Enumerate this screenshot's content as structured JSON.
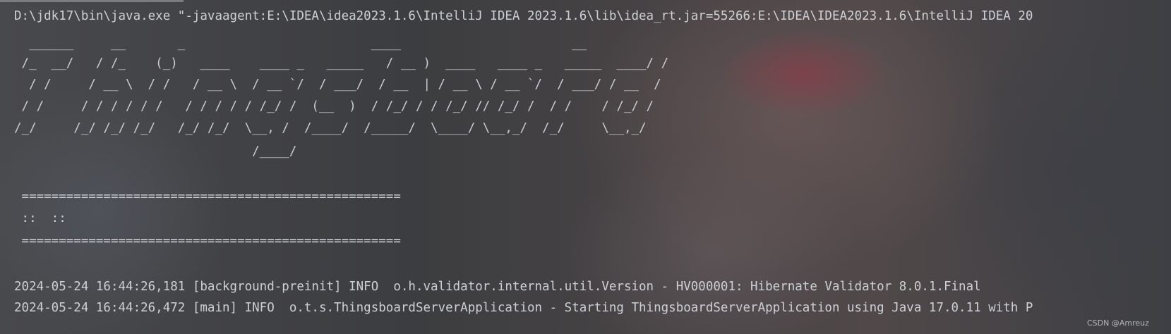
{
  "console": {
    "command_line": "D:\\jdk17\\bin\\java.exe \"-javaagent:E:\\IDEA\\idea2023.1.6\\IntelliJ IDEA 2023.1.6\\lib\\idea_rt.jar=55266:E:\\IDEA\\IDEA2023.1.6\\IntelliJ IDEA 20",
    "banner_lines": [
      "  ______     __       _                         ____                       __",
      " /_  __/   / /_    (_)   ____    ____ _   _____   / __ )  ____   ____ _   _____  ____/ /",
      "  / /     / __ \\  / /   / __ \\  / __ `/  / ___/  / __  | / __ \\ / __ `/  / ___/ / __  /",
      " / /     / / / / / /   / / / / / /_/ /  (__  )  / /_/ / / /_/ // /_/ /  / /    / /_/ /",
      "/_/     /_/ /_/ /_/   /_/ /_/  \\__, /  /____/  /_____/  \\____/ \\__,_/  /_/     \\__,_/",
      "                                /____/"
    ],
    "separator_top": " ===================================================",
    " info_line": "",
    "info_line": " ::  ::",
    "separator_bottom": " ===================================================",
    "log_lines": [
      "2024-05-24 16:44:26,181 [background-preinit] INFO  o.h.validator.internal.util.Version - HV000001: Hibernate Validator 8.0.1.Final",
      "2024-05-24 16:44:26,472 [main] INFO  o.t.s.ThingsboardServerApplication - Starting ThingsboardServerApplication using Java 17.0.11 with P"
    ],
    "watermark": "CSDN @Amreuz"
  }
}
